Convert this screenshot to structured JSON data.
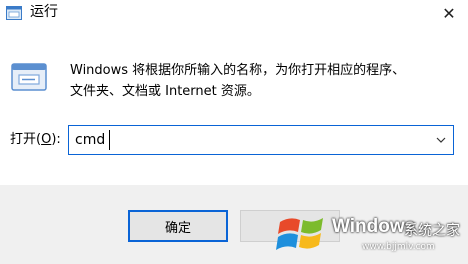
{
  "window": {
    "title": "运行",
    "close_glyph": "✕"
  },
  "description": {
    "line1": "Windows 将根据你所输入的名称，为你打开相应的程序、",
    "line2": "文件夹、文档或 Internet 资源。"
  },
  "open_field": {
    "label_prefix": "打开(",
    "label_hotkey": "O",
    "label_suffix": "):",
    "value": "cmd"
  },
  "buttons": {
    "ok_label": "确定",
    "cancel_label": ""
  },
  "watermark": {
    "brand": "Windows",
    "site_cn": "系统之家",
    "url": "www.bjjmlv.com"
  },
  "colors": {
    "accent": "#0a64d6",
    "footer_bg": "#f0f0f0",
    "button_bg": "#e5e5e5"
  }
}
